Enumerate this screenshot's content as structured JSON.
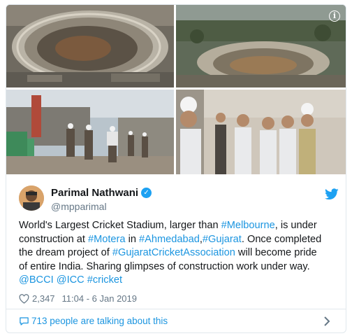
{
  "media": {
    "images": [
      {
        "icon": "stadium-aerial-photo"
      },
      {
        "icon": "stadium-wide-aerial-photo"
      },
      {
        "icon": "construction-site-visit-photo"
      },
      {
        "icon": "officials-inspection-photo"
      }
    ],
    "info_icon": "info-icon"
  },
  "tweet": {
    "author": {
      "name": "Parimal Nathwani",
      "handle": "@mpparimal",
      "verified": true
    },
    "text_lines": [
      [
        {
          "t": "World's Largest Cricket Stadium, larger than ",
          "link": false
        },
        {
          "t": "#Melbourne",
          "link": true
        },
        {
          "t": ", is under",
          "link": false
        }
      ],
      [
        {
          "t": "construction at ",
          "link": false
        },
        {
          "t": "#Motera",
          "link": true
        },
        {
          "t": " in ",
          "link": false
        },
        {
          "t": "#Ahmedabad",
          "link": true
        },
        {
          "t": ",",
          "link": false
        },
        {
          "t": "#Gujarat",
          "link": true
        },
        {
          "t": ". Once completed",
          "link": false
        }
      ],
      [
        {
          "t": "the dream project of ",
          "link": false
        },
        {
          "t": "#GujaratCricketAssociation",
          "link": true
        },
        {
          "t": " will become pride",
          "link": false
        }
      ],
      [
        {
          "t": "of entire India. Sharing glimpses of construction work under way.",
          "link": false
        }
      ],
      [
        {
          "t": "@BCCI",
          "link": true
        },
        {
          "t": " ",
          "link": false
        },
        {
          "t": "@ICC",
          "link": true
        },
        {
          "t": " ",
          "link": false
        },
        {
          "t": "#cricket",
          "link": true
        }
      ]
    ],
    "likes": "2,347",
    "timestamp": "11:04 - 6 Jan 2019",
    "talking": "713 people are talking about this"
  },
  "colors": {
    "link": "#1b95e0",
    "twitter_blue": "#1da1f2",
    "muted": "#657786",
    "border": "#e1e8ed"
  }
}
